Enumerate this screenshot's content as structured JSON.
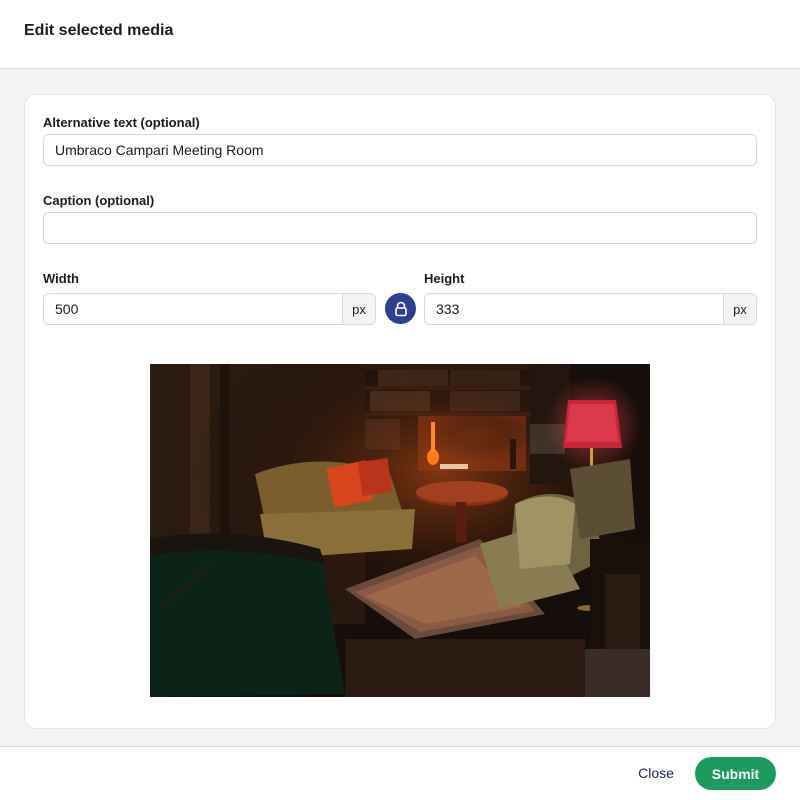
{
  "header": {
    "title": "Edit selected media"
  },
  "form": {
    "alt_text": {
      "label": "Alternative text (optional)",
      "value": "Umbraco Campari Meeting Room"
    },
    "caption": {
      "label": "Caption (optional)",
      "value": ""
    },
    "width": {
      "label": "Width",
      "value": "500",
      "unit": "px"
    },
    "height": {
      "label": "Height",
      "value": "333",
      "unit": "px"
    },
    "lock_icon": "lock-icon"
  },
  "footer": {
    "close_label": "Close",
    "submit_label": "Submit"
  },
  "colors": {
    "accent": "#2e3f93",
    "submit": "#1f9a5f",
    "text": "#1b264f"
  }
}
